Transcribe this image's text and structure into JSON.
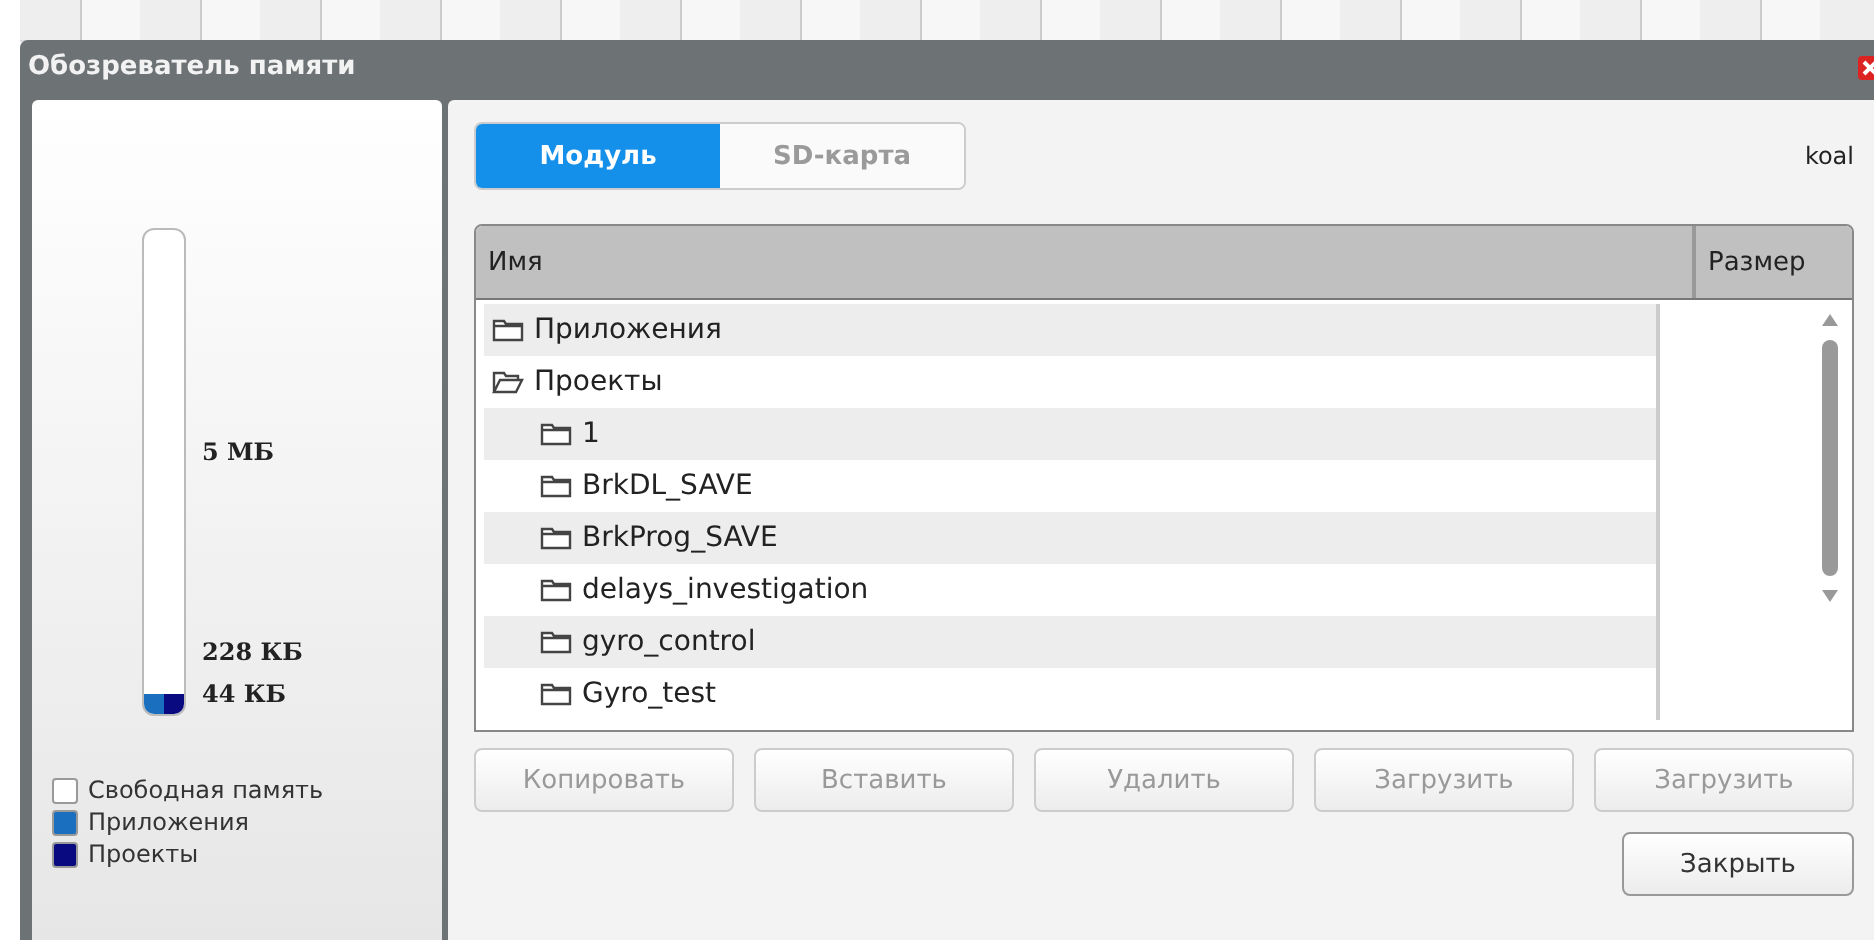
{
  "window": {
    "title": "Обозреватель памяти"
  },
  "memory": {
    "level": 0.04,
    "scale_labels": [
      "5 МБ",
      "228 КБ",
      "44 КБ"
    ],
    "legend": [
      {
        "label": "Свободная память",
        "color": "#ffffff"
      },
      {
        "label": "Приложения",
        "color": "#1a6fbf"
      },
      {
        "label": "Проекты",
        "color": "#0a0a80"
      }
    ]
  },
  "tabs": [
    {
      "label": "Модуль",
      "selected": true
    },
    {
      "label": "SD-карта",
      "selected": false
    }
  ],
  "user": "koal",
  "table": {
    "columns": [
      "Имя",
      "Размер"
    ],
    "rows": [
      {
        "name": "Приложения",
        "expanded": false,
        "children": []
      },
      {
        "name": "Проекты",
        "expanded": true,
        "children": [
          {
            "name": "1"
          },
          {
            "name": "BrkDL_SAVE"
          },
          {
            "name": "BrkProg_SAVE"
          },
          {
            "name": "delays_investigation"
          },
          {
            "name": "gyro_control"
          },
          {
            "name": "Gyro_test"
          }
        ]
      }
    ]
  },
  "buttons": [
    {
      "label": "Копировать",
      "disabled": true
    },
    {
      "label": "Вставить",
      "disabled": true
    },
    {
      "label": "Удалить",
      "disabled": true
    },
    {
      "label": "Загрузить",
      "disabled": true
    },
    {
      "label": "Загрузить",
      "disabled": true
    }
  ],
  "close_button": {
    "label": "Закрыть",
    "disabled": false
  }
}
